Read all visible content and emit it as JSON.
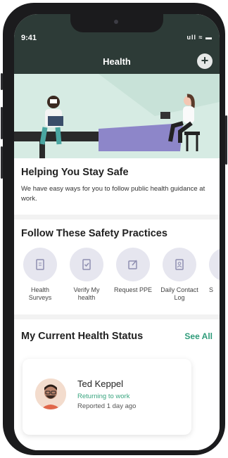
{
  "status_bar": {
    "time": "9:41",
    "indicators": "ull ≈ ▬"
  },
  "header": {
    "title": "Health",
    "add_button": "+"
  },
  "safe": {
    "title": "Helping You Stay Safe",
    "description": "We have easy ways for you to follow public health guidance at work."
  },
  "practices": {
    "title": "Follow These Safety Practices",
    "items": [
      {
        "label": "Health Surveys",
        "icon": "survey-icon"
      },
      {
        "label": "Verify My health",
        "icon": "verify-icon"
      },
      {
        "label": "Request PPE",
        "icon": "edit-icon"
      },
      {
        "label": "Daily Contact Log",
        "icon": "contact-log-icon"
      },
      {
        "label": "S",
        "icon": "more-icon"
      }
    ]
  },
  "status": {
    "title": "My Current Health Status",
    "see_all": "See All",
    "person": {
      "name": "Ted Keppel",
      "state": "Returning to work",
      "reported": "Reported 1 day ago"
    }
  },
  "colors": {
    "header_bg": "#2d3b37",
    "accent": "#2f9c7a",
    "hero_bg": "#d6ebe3",
    "practice_circle": "#e6e6ef"
  }
}
